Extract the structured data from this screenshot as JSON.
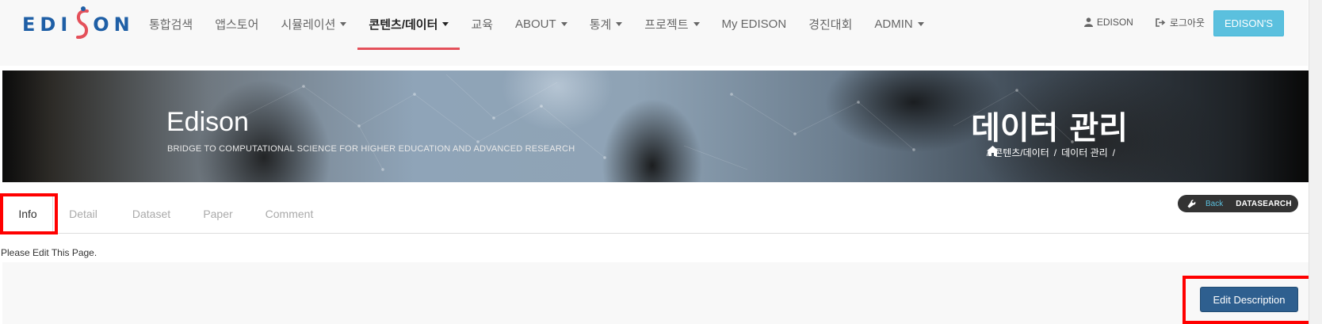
{
  "app": {
    "logo_text_left": "EDI",
    "logo_text_right": "ON"
  },
  "nav": {
    "items": [
      {
        "label": "통합검색",
        "caret": false
      },
      {
        "label": "앱스토어",
        "caret": false
      },
      {
        "label": "시뮬레이션",
        "caret": true
      },
      {
        "label": "콘텐츠/데이터",
        "caret": true
      },
      {
        "label": "교육",
        "caret": false
      },
      {
        "label": "ABOUT",
        "caret": true
      },
      {
        "label": "통계",
        "caret": true
      },
      {
        "label": "프로젝트",
        "caret": true
      },
      {
        "label": "My EDISON",
        "caret": false
      },
      {
        "label": "경진대회",
        "caret": false
      },
      {
        "label": "ADMIN",
        "caret": true
      }
    ],
    "active_index": 3,
    "user_label": "EDISON",
    "logout_label": "로그아웃",
    "edisons_button": "EDISON'S"
  },
  "banner": {
    "title": "Edison",
    "subtitle": "BRIDGE TO COMPUTATIONAL SCIENCE FOR HIGHER EDUCATION AND ADVANCED RESEARCH",
    "page_title": "데이터 관리",
    "breadcrumb": [
      "콘텐츠/데이터",
      "데이터 관리"
    ]
  },
  "tabs": [
    "Info",
    "Detail",
    "Dataset",
    "Paper",
    "Comment"
  ],
  "active_tab": "Info",
  "pill": {
    "back_label": "Back",
    "datasearch_label": "DATASEARCH"
  },
  "content": {
    "text": "Please Edit This Page."
  },
  "edit_button": "Edit Description",
  "colors": {
    "nav_active_underline": "#e4505a",
    "edisons_button": "#5bc0de",
    "edit_button": "#2e5f8f",
    "highlight": "#ff0000",
    "logo_blue": "#1f5fa6"
  }
}
